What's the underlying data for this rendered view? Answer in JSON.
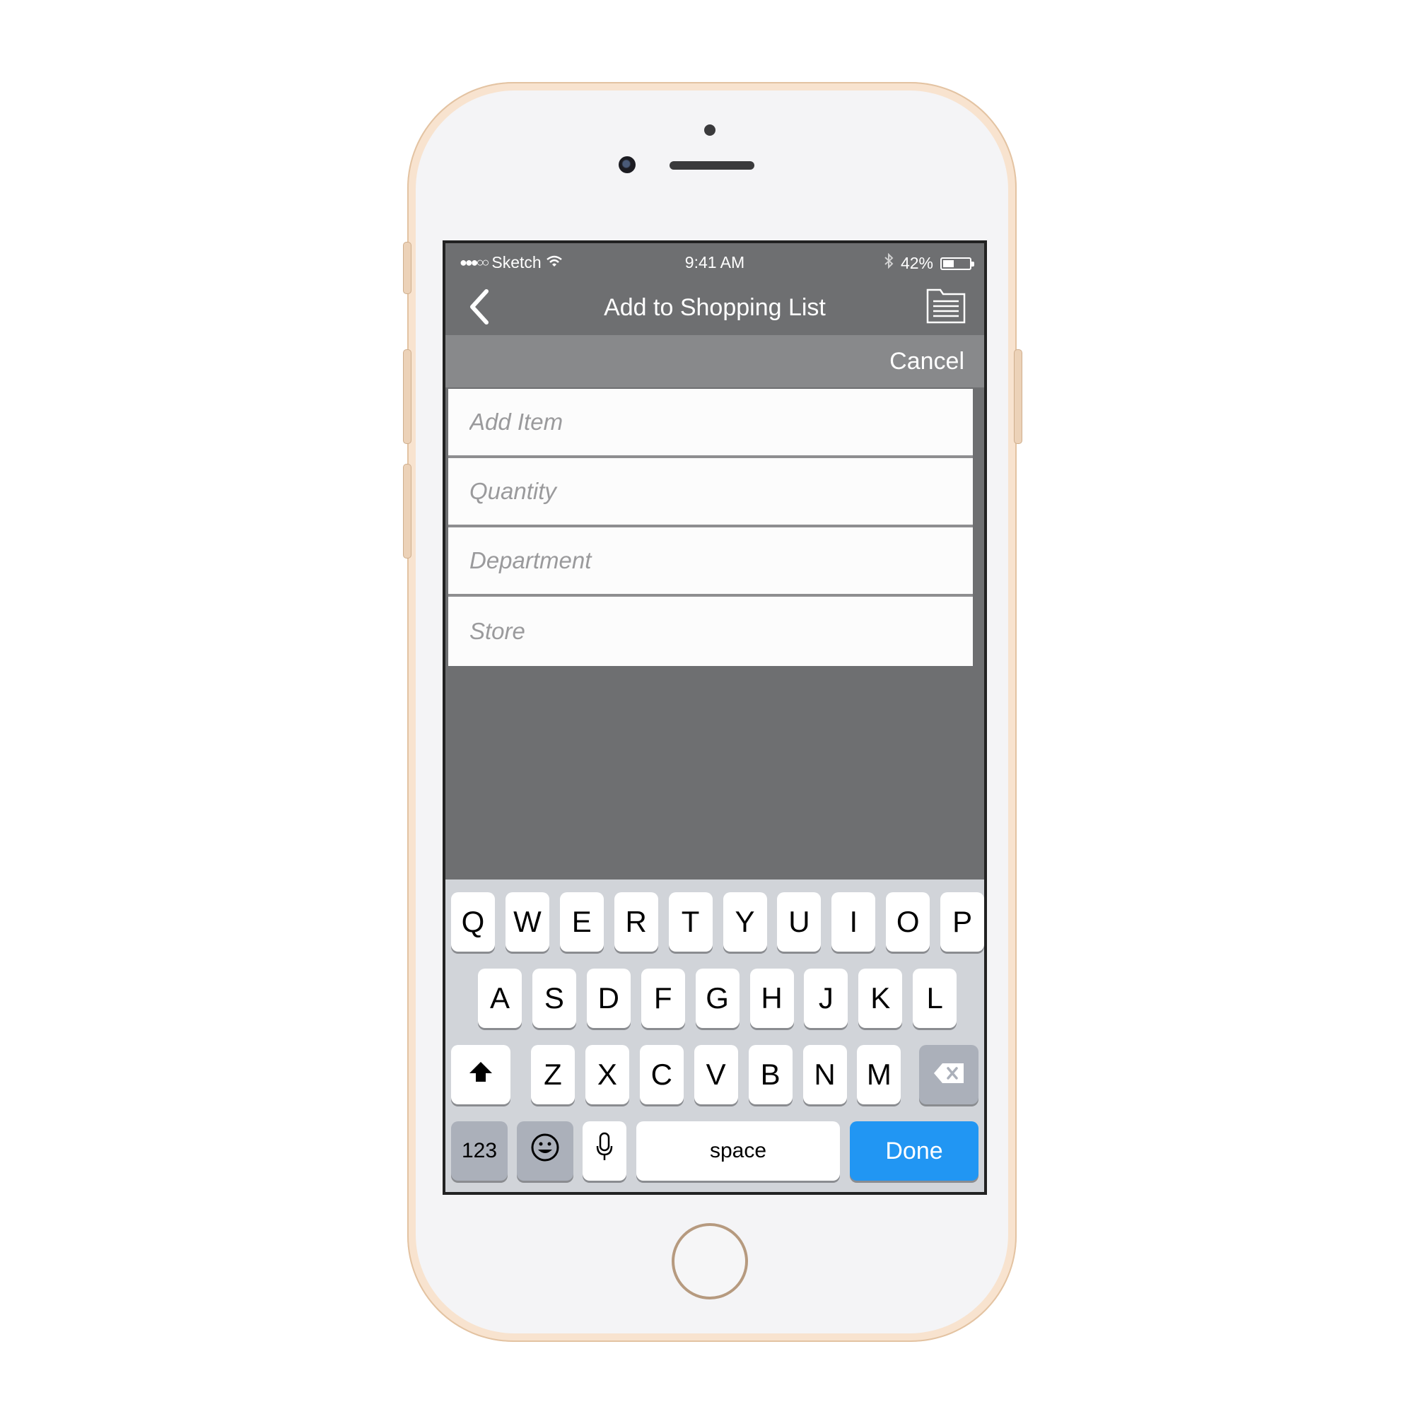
{
  "status_bar": {
    "carrier_signal": "●●●○○",
    "carrier": "Sketch",
    "wifi_icon": "wifi-icon",
    "time": "9:41 AM",
    "bluetooth_icon": "bluetooth-icon",
    "battery_text": "42%",
    "battery_level": 0.42
  },
  "nav": {
    "title": "Add to Shopping List",
    "back_icon": "chevron-left-icon",
    "list_icon": "list-document-icon"
  },
  "cancel_bar": {
    "cancel_label": "Cancel"
  },
  "form": {
    "fields": [
      {
        "placeholder": "Add Item",
        "value": ""
      },
      {
        "placeholder": "Quantity",
        "value": ""
      },
      {
        "placeholder": "Department",
        "value": ""
      },
      {
        "placeholder": "Store",
        "value": ""
      }
    ]
  },
  "keyboard": {
    "row1": [
      "Q",
      "W",
      "E",
      "R",
      "T",
      "Y",
      "U",
      "I",
      "O",
      "P"
    ],
    "row2": [
      "A",
      "S",
      "D",
      "F",
      "G",
      "H",
      "J",
      "K",
      "L"
    ],
    "row3": [
      "Z",
      "X",
      "C",
      "V",
      "B",
      "N",
      "M"
    ],
    "shift_icon": "shift-arrow-icon",
    "delete_icon": "backspace-icon",
    "numbers_label": "123",
    "emoji_icon": "emoji-icon",
    "mic_icon": "microphone-icon",
    "space_label": "space",
    "done_label": "Done"
  },
  "colors": {
    "app_gray": "#6e6f71",
    "cancel_bar": "#88898b",
    "done_blue": "#2196f3",
    "phone_gold": "#f8e3cf"
  }
}
